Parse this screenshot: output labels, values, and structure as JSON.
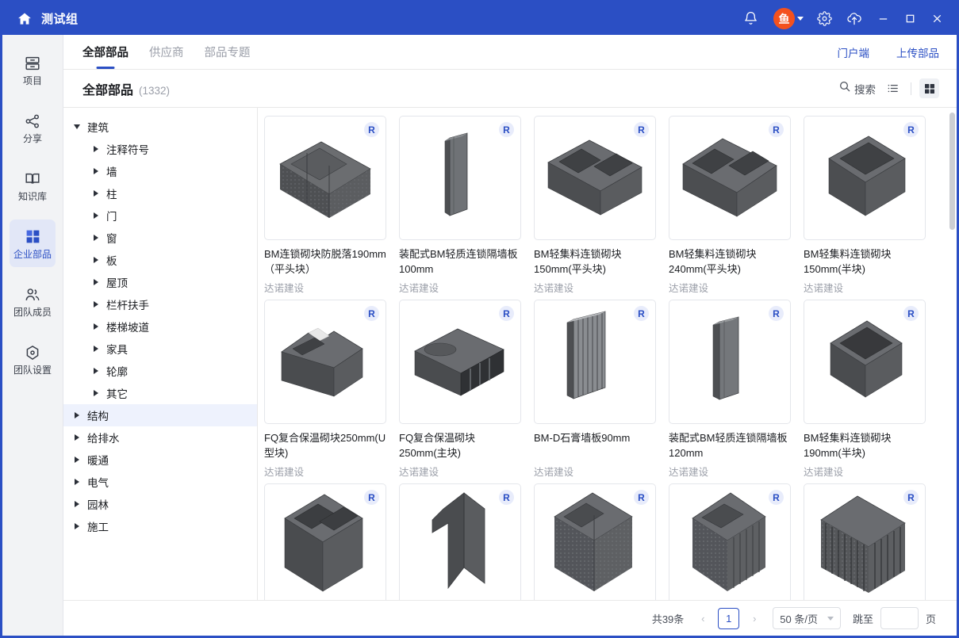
{
  "titlebar": {
    "app_title": "测试组",
    "home_icon": "home-icon",
    "bell_icon": "bell-icon",
    "avatar_text": "鱼",
    "gear_icon": "gear-icon",
    "upload_cloud_icon": "upload-cloud-icon",
    "minimize_label": "—",
    "maximize_label": "□",
    "close_label": "✕"
  },
  "sidebar": {
    "items": [
      {
        "label": "项目",
        "icon": "project-icon",
        "active": false
      },
      {
        "label": "分享",
        "icon": "share-icon",
        "active": false
      },
      {
        "label": "知识库",
        "icon": "book-icon",
        "active": false
      },
      {
        "label": "企业部品",
        "icon": "grid-squares-icon",
        "active": true
      },
      {
        "label": "团队成员",
        "icon": "users-icon",
        "active": false
      },
      {
        "label": "团队设置",
        "icon": "settings-hexagon-icon",
        "active": false
      }
    ]
  },
  "tabs": [
    {
      "label": "全部部品",
      "active": true
    },
    {
      "label": "供应商",
      "active": false
    },
    {
      "label": "部品专题",
      "active": false
    }
  ],
  "header_links": [
    {
      "label": "门户端"
    },
    {
      "label": "上传部品"
    }
  ],
  "subbar": {
    "title": "全部部品",
    "count": "(1332)",
    "search_label": "搜索",
    "search_icon": "search-icon",
    "list_view_icon": "list-view-icon",
    "grid_view_icon": "grid-view-icon"
  },
  "tree": [
    {
      "label": "建筑",
      "level": 0,
      "expanded": true,
      "selected": false
    },
    {
      "label": "注释符号",
      "level": 1,
      "expanded": false,
      "selected": false
    },
    {
      "label": "墙",
      "level": 1,
      "expanded": false,
      "selected": false
    },
    {
      "label": "柱",
      "level": 1,
      "expanded": false,
      "selected": false
    },
    {
      "label": "门",
      "level": 1,
      "expanded": false,
      "selected": false
    },
    {
      "label": "窗",
      "level": 1,
      "expanded": false,
      "selected": false
    },
    {
      "label": "板",
      "level": 1,
      "expanded": false,
      "selected": false
    },
    {
      "label": "屋顶",
      "level": 1,
      "expanded": false,
      "selected": false
    },
    {
      "label": "栏杆扶手",
      "level": 1,
      "expanded": false,
      "selected": false
    },
    {
      "label": "楼梯坡道",
      "level": 1,
      "expanded": false,
      "selected": false
    },
    {
      "label": "家具",
      "level": 1,
      "expanded": false,
      "selected": false
    },
    {
      "label": "轮廓",
      "level": 1,
      "expanded": false,
      "selected": false
    },
    {
      "label": "其它",
      "level": 1,
      "expanded": false,
      "selected": false
    },
    {
      "label": "结构",
      "level": 0,
      "expanded": false,
      "selected": true
    },
    {
      "label": "给排水",
      "level": 0,
      "expanded": false,
      "selected": false
    },
    {
      "label": "暖通",
      "level": 0,
      "expanded": false,
      "selected": false
    },
    {
      "label": "电气",
      "level": 0,
      "expanded": false,
      "selected": false
    },
    {
      "label": "园林",
      "level": 0,
      "expanded": false,
      "selected": false
    },
    {
      "label": "施工",
      "level": 0,
      "expanded": false,
      "selected": false
    }
  ],
  "cards": [
    {
      "title": "BM连锁砌块防脱落190mm（平头块）",
      "supplier": "达诺建设",
      "badge": "R",
      "shape": "block-double-hollow-textured"
    },
    {
      "title": "装配式BM轻质连锁隔墙板100mm",
      "supplier": "达诺建设",
      "badge": "R",
      "shape": "panel-thin"
    },
    {
      "title": "BM轻集料连锁砌块150mm(平头块)",
      "supplier": "达诺建设",
      "badge": "R",
      "shape": "block-double-hollow"
    },
    {
      "title": "BM轻集料连锁砌块240mm(平头块)",
      "supplier": "达诺建设",
      "badge": "R",
      "shape": "block-double-hollow"
    },
    {
      "title": "BM轻集料连锁砌块150mm(半块)",
      "supplier": "达诺建设",
      "badge": "R",
      "shape": "block-single-hollow"
    },
    {
      "title": "FQ复合保温砌块250mm(U型块)",
      "supplier": "达诺建设",
      "badge": "R",
      "shape": "block-u-shape"
    },
    {
      "title": "FQ复合保温砌块250mm(主块)",
      "supplier": "达诺建设",
      "badge": "R",
      "shape": "block-main"
    },
    {
      "title": "BM-D石膏墙板90mm",
      "supplier": "达诺建设",
      "badge": "R",
      "shape": "panel-ribbed"
    },
    {
      "title": "装配式BM轻质连锁隔墙板120mm",
      "supplier": "达诺建设",
      "badge": "R",
      "shape": "panel-thin"
    },
    {
      "title": "BM轻集料连锁砌块190mm(半块)",
      "supplier": "达诺建设",
      "badge": "R",
      "shape": "block-open-box"
    },
    {
      "title": "",
      "supplier": "",
      "badge": "R",
      "shape": "block-double-hollow-tall"
    },
    {
      "title": "",
      "supplier": "",
      "badge": "R",
      "shape": "block-angle-tall"
    },
    {
      "title": "",
      "supplier": "",
      "badge": "R",
      "shape": "block-textured-tall"
    },
    {
      "title": "",
      "supplier": "",
      "badge": "R",
      "shape": "block-textured-solid-tall"
    },
    {
      "title": "",
      "supplier": "",
      "badge": "R",
      "shape": "block-striped-tall"
    }
  ],
  "pagination": {
    "total_label": "共39条",
    "prev_label": "‹",
    "current_page": "1",
    "next_label": "›",
    "page_size_label": "50 条/页",
    "jump_label": "跳至",
    "jump_value": "",
    "page_unit": "页"
  },
  "colors": {
    "brand_blue": "#2b4fc4",
    "avatar_orange": "#f4511e",
    "active_bg": "#e2e7f7",
    "muted_text": "#9a9ea8"
  }
}
